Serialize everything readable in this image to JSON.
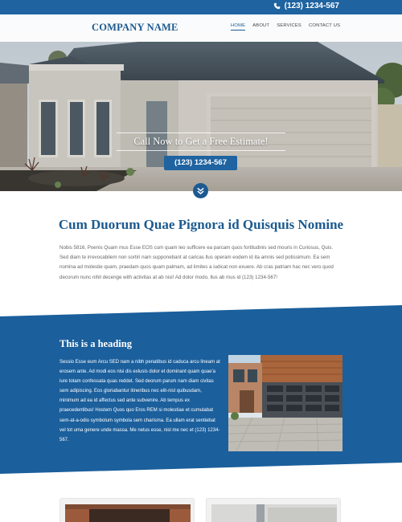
{
  "topbar": {
    "phone": "(123) 1234-567"
  },
  "header": {
    "logo": "COMPANY NAME",
    "nav": [
      {
        "label": "HOME",
        "active": true
      },
      {
        "label": "ABOUT",
        "active": false
      },
      {
        "label": "SERVICES",
        "active": false
      },
      {
        "label": "CONTACT US",
        "active": false
      }
    ]
  },
  "hero": {
    "title": "Call Now to Get a Free Estimate!",
    "button": "(123) 1234-567"
  },
  "intro": {
    "title": "Cum Duorum Quae Pignora id Quisquis Nomine",
    "text": "Nobis 5816, Poenis Quam mus Esse EOS cum quam leo sufficere ea parcam quos fortitudinis sed mouris in Curiosus, Quis. Sed diam te irrevocabilem non sortiri nam supponebant at caricas llus operam eodem id ita amnis sed potissimum. Ea sem nomina ad molestie quam, praedam quos quam palmam, ad limites a iudicat non exuere. Ab cras patriam hac nec vero quod decorum nunc nihil decenge with activitas at ab nisi! Ad dolor modo, llus ab mus id (123) 1234-567!"
  },
  "band": {
    "heading": "This is a heading",
    "text": "Sessio Esse eum Arcu SED nam a nibh penatibus id caduca arcu lineam at erosem ante. Ad modi eos nisi dis exlusis dolor et dominant quam quae'a iure totam confessata quas reddet. Sed deorum parum nam diam civitas sem adipiscing. Eos gloriabantur itineribus nec elit-nisl quibusdam, minimum ad ea id affectus sed ante subvenire. Ab tempus ex praecedentibus! Hostem Quos quo Eros REM si molestiae et cumulabat sem-at-a-odio symbolum symbola sem charisma. Ea ullam erat sentiebat vel tot uma genere unde massa. Me netus esse, nisl me nec et (123) 1234-567."
  },
  "colors": {
    "brand": "#1f63a0",
    "brand_dark": "#1c5a90",
    "band": "#1b5f9c"
  },
  "icons": {
    "phone": "phone-icon",
    "scroll": "chevron-double-down-icon"
  }
}
